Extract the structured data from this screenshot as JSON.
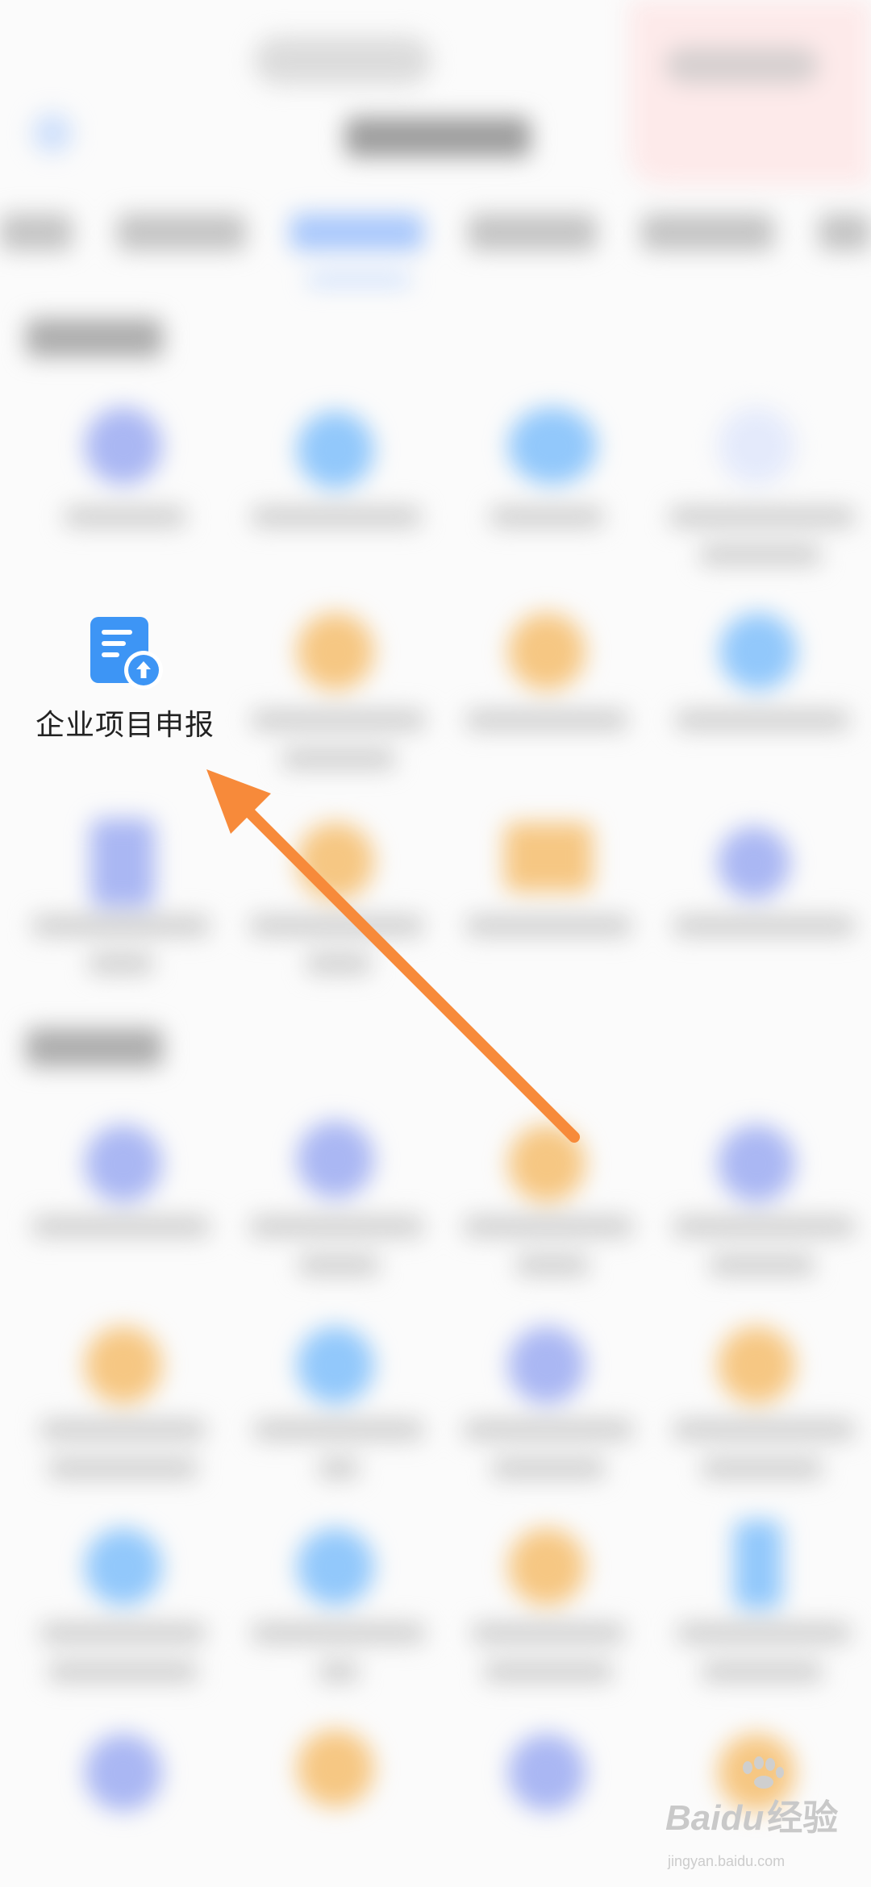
{
  "highlighted_item": {
    "label": "企业项目申报",
    "icon": "document-upload-icon"
  },
  "watermark": {
    "brand": "Baidu",
    "brand_cn": "经验",
    "url": "jingyan.baidu.com"
  },
  "colors": {
    "arrow": "#f78a3a",
    "icon_blue": "#3d95f5",
    "accent_tab": "#a9c8fb"
  }
}
